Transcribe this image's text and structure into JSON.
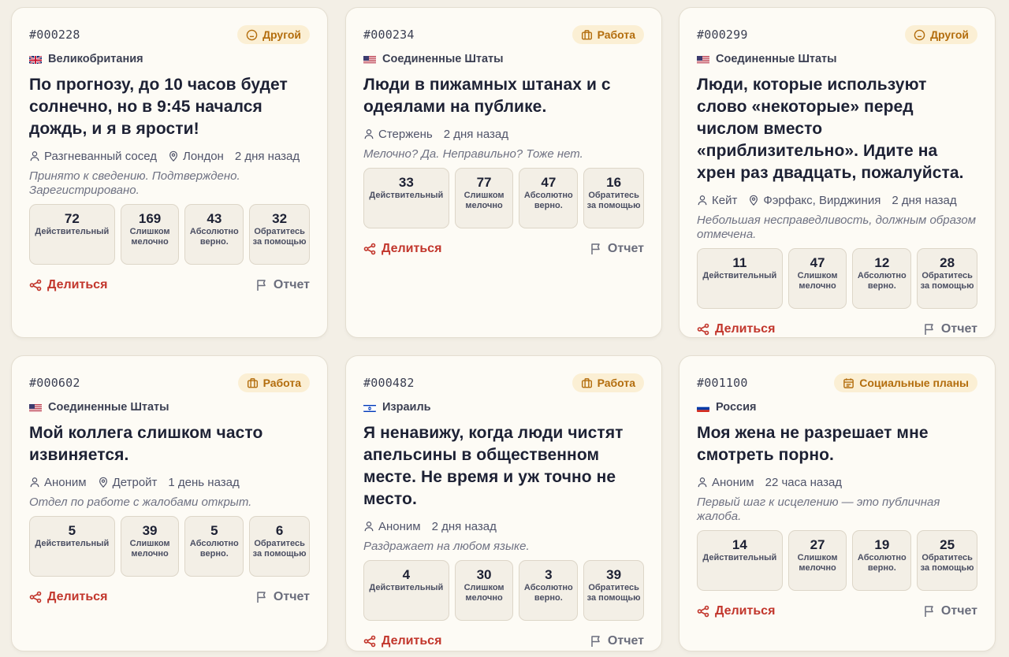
{
  "labels": {
    "stat_valid": "Действительный",
    "stat_petty": "Слишком мелочно",
    "stat_right": "Абсолютно верно.",
    "stat_help": "Обратитесь за помощью",
    "share": "Делиться",
    "report": "Отчет"
  },
  "colors": {
    "accent": "#c2362c",
    "badge_bg": "#fbefd4",
    "badge_text": "#b36d0d",
    "background": "#f3efe6",
    "card": "#fdfbf5"
  },
  "cards": [
    {
      "id": "#000228",
      "category": "Другой",
      "category_icon": "smile-icon",
      "flag": "gb",
      "country": "Великобритания",
      "title": "По прогнозу, до 10 часов будет солнечно, но в 9:45 начался дождь, и я в ярости!",
      "author": "Разгневанный сосед",
      "location": "Лондон",
      "time": "2 дня назад",
      "quote": "Принято к сведению. Подтверждено. Зарегистрировано.",
      "stats": [
        72,
        169,
        43,
        32
      ]
    },
    {
      "id": "#000234",
      "category": "Работа",
      "category_icon": "briefcase-icon",
      "flag": "us",
      "country": "Соединенные Штаты",
      "title": "Люди в пижамных штанах и с одеялами на публике.",
      "author": "Стержень",
      "location": "",
      "time": "2 дня назад",
      "quote": "Мелочно? Да. Неправильно? Тоже нет.",
      "stats": [
        33,
        77,
        47,
        16
      ]
    },
    {
      "id": "#000299",
      "category": "Другой",
      "category_icon": "smile-icon",
      "flag": "us",
      "country": "Соединенные Штаты",
      "title": "Люди, которые используют слово «некоторые» перед числом вместо «приблизительно». Идите на хрен раз двадцать, пожалуйста.",
      "author": "Кейт",
      "location": "Фэрфакс, Вирджиния",
      "time": "2 дня назад",
      "quote": "Небольшая несправедливость, должным образом отмечена.",
      "stats": [
        11,
        47,
        12,
        28
      ]
    },
    {
      "id": "#000602",
      "category": "Работа",
      "category_icon": "briefcase-icon",
      "flag": "us",
      "country": "Соединенные Штаты",
      "title": "Мой коллега слишком часто извиняется.",
      "author": "Аноним",
      "location": "Детройт",
      "time": "1 день назад",
      "quote": "Отдел по работе с жалобами открыт.",
      "stats": [
        5,
        39,
        5,
        6
      ]
    },
    {
      "id": "#000482",
      "category": "Работа",
      "category_icon": "briefcase-icon",
      "flag": "il",
      "country": "Израиль",
      "title": "Я ненавижу, когда люди чистят апельсины в общественном месте. Не время и уж точно не место.",
      "author": "Аноним",
      "location": "",
      "time": "2 дня назад",
      "quote": "Раздражает на любом языке.",
      "stats": [
        4,
        30,
        3,
        39
      ]
    },
    {
      "id": "#001100",
      "category": "Социальные планы",
      "category_icon": "calendar-icon",
      "flag": "ru",
      "country": "Россия",
      "title": "Моя жена не разрешает мне смотреть порно.",
      "author": "Аноним",
      "location": "",
      "time": "22 часа назад",
      "quote": "Первый шаг к исцелению — это публичная жалоба.",
      "stats": [
        14,
        27,
        19,
        25
      ]
    }
  ]
}
